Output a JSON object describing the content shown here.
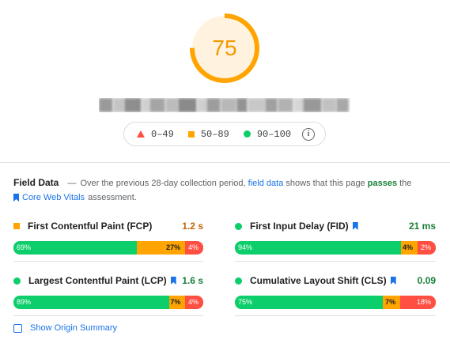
{
  "score": {
    "value": "75",
    "fraction": 0.75,
    "color": "#ffa400"
  },
  "legend": {
    "items": [
      {
        "label": "0–49",
        "icon": "red-triangle-icon",
        "color": "#ff4e42"
      },
      {
        "label": "50–89",
        "icon": "orange-square-icon",
        "color": "#ffa400"
      },
      {
        "label": "90–100",
        "icon": "green-circle-icon",
        "color": "#0cce6b"
      }
    ],
    "info_icon": "info-icon"
  },
  "field_data": {
    "title": "Field Data",
    "dash": "—",
    "text_before_link": "Over the previous 28-day collection period,",
    "link_text": "field data",
    "text_middle": "shows that this page",
    "passes_text": "passes",
    "text_after": "the",
    "cwv_link": "Core Web Vitals",
    "cwv_after": "assessment."
  },
  "metrics": {
    "fcp": {
      "name": "First Contentful Paint (FCP)",
      "value": "1.2 s",
      "indicator": "orange-square-icon",
      "good": "69%",
      "ni": "27%",
      "poor": "4%",
      "good_pct": 69,
      "ni_pct": 27,
      "poor_pct": 4,
      "core": false
    },
    "fid": {
      "name": "First Input Delay (FID)",
      "value": "21 ms",
      "indicator": "green-circle-icon",
      "good": "94%",
      "ni": "4%",
      "poor": "2%",
      "good_pct": 94,
      "ni_pct": 4,
      "poor_pct": 2,
      "core": true
    },
    "lcp": {
      "name": "Largest Contentful Paint (LCP)",
      "value": "1.6 s",
      "indicator": "green-circle-icon",
      "good": "89%",
      "ni": "7%",
      "poor": "4%",
      "good_pct": 89,
      "ni_pct": 7,
      "poor_pct": 4,
      "core": true
    },
    "cls": {
      "name": "Cumulative Layout Shift (CLS)",
      "value": "0.09",
      "indicator": "green-circle-icon",
      "good": "75%",
      "ni": "7%",
      "poor": "18%",
      "good_pct": 75,
      "ni_pct": 7,
      "poor_pct": 18,
      "core": true
    }
  },
  "origin_summary": {
    "label": "Show Origin Summary",
    "checked": false
  },
  "colors": {
    "good": "#0cce6b",
    "average": "#ffa400",
    "poor": "#ff4e42",
    "link": "#1a73e8",
    "pass": "#188038"
  }
}
